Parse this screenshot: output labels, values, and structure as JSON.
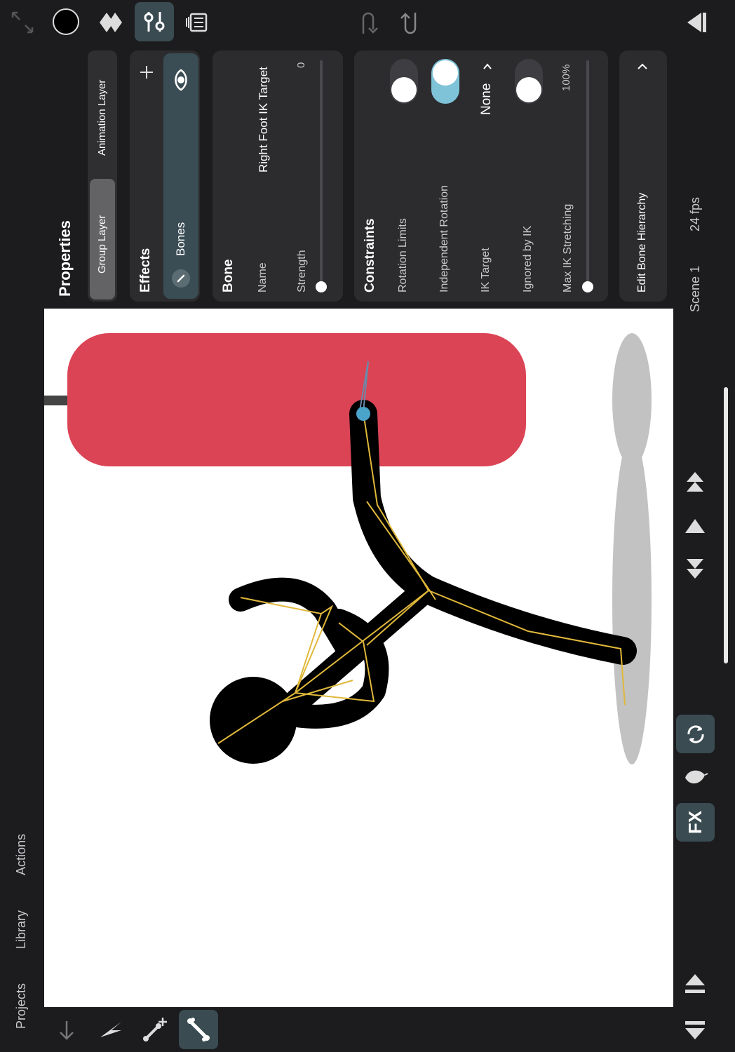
{
  "top_toolbar": {
    "icons": [
      "collapse-icon",
      "color-circle-icon",
      "diamond-icon",
      "sliders-icon",
      "stack-icon",
      "undo-icon",
      "redo-icon",
      "play-back-icon"
    ]
  },
  "properties": {
    "title": "Properties",
    "layer_tabs": {
      "group": "Group Layer",
      "animation": "Animation Layer"
    },
    "effects": {
      "title": "Effects",
      "item": "Bones"
    },
    "bone": {
      "title": "Bone",
      "name_label": "Name",
      "name_value": "Right Foot IK Target",
      "strength_label": "Strength",
      "strength_value": "0"
    },
    "constraints": {
      "title": "Constraints",
      "rotation_limits": "Rotation Limits",
      "independent_rotation": "Independent Rotation",
      "ik_target_label": "IK Target",
      "ik_target_value": "None",
      "ignored_by_ik": "Ignored by IK",
      "max_ik_stretching_label": "Max IK Stretching",
      "max_ik_stretching_value": "100%"
    },
    "edit_hierarchy": "Edit Bone Hierarchy"
  },
  "status": {
    "scene": "Scene 1",
    "fps": "24 fps"
  },
  "bottom_nav": {
    "projects": "Projects",
    "library": "Library",
    "actions": "Actions"
  },
  "right_tools": {
    "fx": "FX"
  },
  "colors": {
    "accent": "#7fc3d9",
    "bag": "#db4455",
    "bone": "#e0b83a",
    "panel": "#2c2c2e"
  }
}
